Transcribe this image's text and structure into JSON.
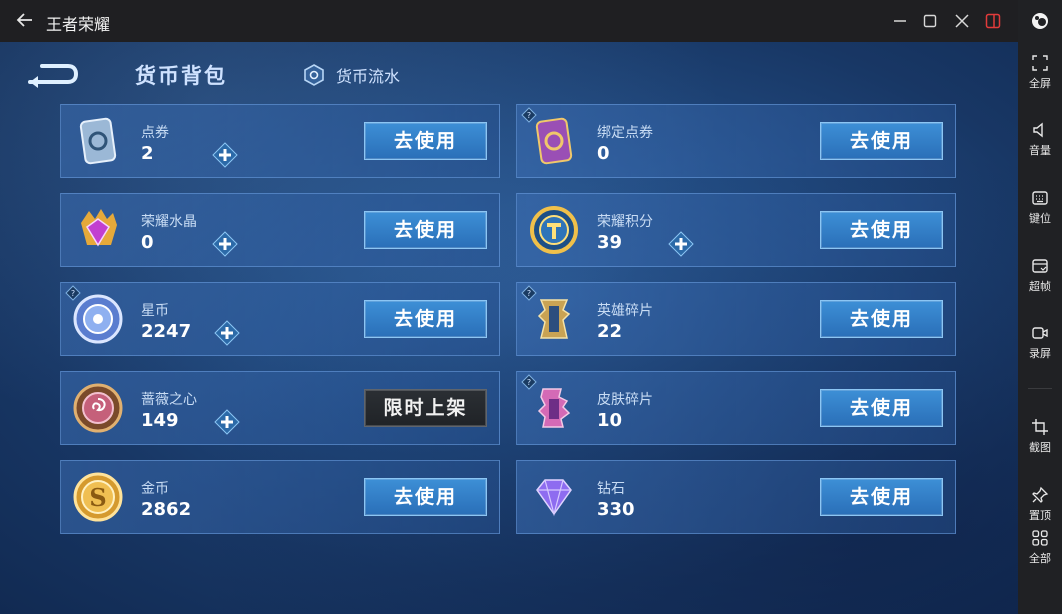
{
  "window": {
    "title": "王者荣耀"
  },
  "sidebar": {
    "items": [
      {
        "label": "全屏",
        "icon": "fullscreen-icon"
      },
      {
        "label": "音量",
        "icon": "volume-icon"
      },
      {
        "label": "键位",
        "icon": "keyboard-icon"
      },
      {
        "label": "超帧",
        "icon": "frame-boost-icon"
      },
      {
        "label": "录屏",
        "icon": "record-icon"
      },
      {
        "label": "截图",
        "icon": "crop-icon"
      },
      {
        "label": "置顶",
        "icon": "pin-icon"
      },
      {
        "label": "全部",
        "icon": "grid-icon"
      }
    ]
  },
  "game": {
    "title": "货币背包",
    "flow_label": "货币流水",
    "currencies": [
      {
        "name": "点券",
        "amount": "2",
        "button": "去使用",
        "icon": "coupon-icon"
      },
      {
        "name": "绑定点券",
        "amount": "0",
        "button": "去使用",
        "icon": "bound-coupon-icon"
      },
      {
        "name": "荣耀水晶",
        "amount": "0",
        "button": "去使用",
        "icon": "crystal-icon"
      },
      {
        "name": "荣耀积分",
        "amount": "39",
        "button": "去使用",
        "icon": "points-icon"
      },
      {
        "name": "星币",
        "amount": "2247",
        "button": "去使用",
        "icon": "star-coin-icon"
      },
      {
        "name": "英雄碎片",
        "amount": "22",
        "button": "去使用",
        "icon": "hero-fragment-icon"
      },
      {
        "name": "蔷薇之心",
        "amount": "149",
        "button": "限时上架",
        "icon": "rose-heart-icon"
      },
      {
        "name": "皮肤碎片",
        "amount": "10",
        "button": "去使用",
        "icon": "skin-fragment-icon"
      },
      {
        "name": "金币",
        "amount": "2862",
        "button": "去使用",
        "icon": "gold-coin-icon"
      },
      {
        "name": "钻石",
        "amount": "330",
        "button": "去使用",
        "icon": "diamond-icon"
      }
    ]
  },
  "colors": {
    "accent": "#2a6fb8",
    "panel": "#183765",
    "titlebar": "#1f1f22"
  }
}
